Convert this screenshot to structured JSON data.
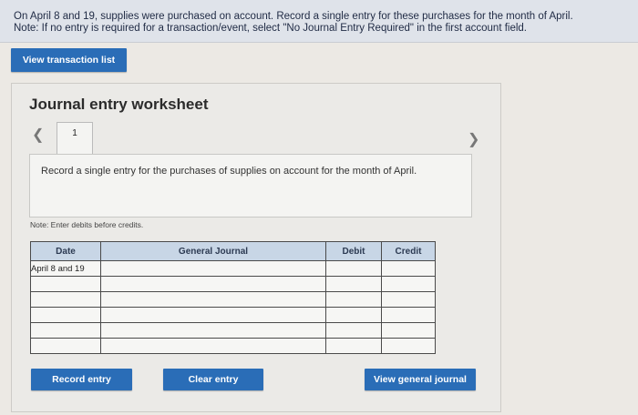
{
  "instructions": {
    "line1": "On April 8 and 19, supplies were purchased on account. Record a single entry for these purchases for the month of April.",
    "line2": "Note: If no entry is required for a transaction/event, select \"No Journal Entry Required\" in the first account field."
  },
  "view_transaction_list": "View transaction list",
  "worksheet": {
    "title": "Journal entry worksheet",
    "tab_number": "1",
    "description": "Record a single entry for the purchases of supplies on account for the month of April.",
    "note": "Note: Enter debits before credits."
  },
  "table": {
    "headers": {
      "date": "Date",
      "general_journal": "General Journal",
      "debit": "Debit",
      "credit": "Credit"
    },
    "first_date": "April 8 and 19"
  },
  "buttons": {
    "record": "Record entry",
    "clear": "Clear entry",
    "view_general_journal": "View general journal"
  },
  "colors": {
    "button_blue": "#2a6db7",
    "header_bg": "#c8d6e6",
    "instructions_bg": "#dfe3ea"
  }
}
